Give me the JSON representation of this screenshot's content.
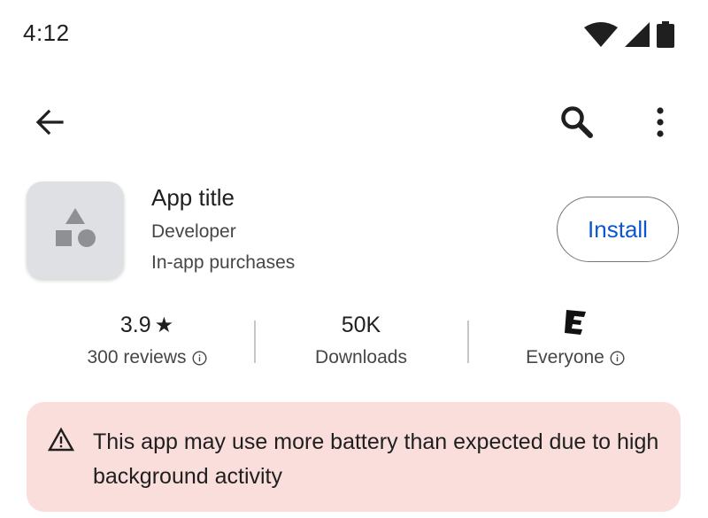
{
  "status_bar": {
    "time": "4:12",
    "icons": [
      "wifi-icon",
      "cell-signal-icon",
      "battery-icon"
    ]
  },
  "top_bar": {
    "icons": [
      "back-arrow-icon",
      "search-icon",
      "more-vert-icon"
    ]
  },
  "app": {
    "title": "App title",
    "developer": "Developer",
    "in_app_purchases": "In-app purchases",
    "install_label": "Install",
    "icon": "app-placeholder-icon"
  },
  "stats": {
    "rating": {
      "value": "3.9",
      "star": "★",
      "label": "300 reviews"
    },
    "downloads": {
      "value": "50K",
      "label": "Downloads"
    },
    "content_rating": {
      "badge": "E",
      "label": "Everyone"
    }
  },
  "warning": {
    "icon": "warning-triangle-icon",
    "text": "This app may use more battery than expected due to high background activity"
  },
  "colors": {
    "accent": "#0b57d0",
    "warning_bg": "#f9dedc",
    "icon_bg": "#dfe0e3",
    "primary_text": "#1f1f1f",
    "secondary_text": "#444746"
  }
}
